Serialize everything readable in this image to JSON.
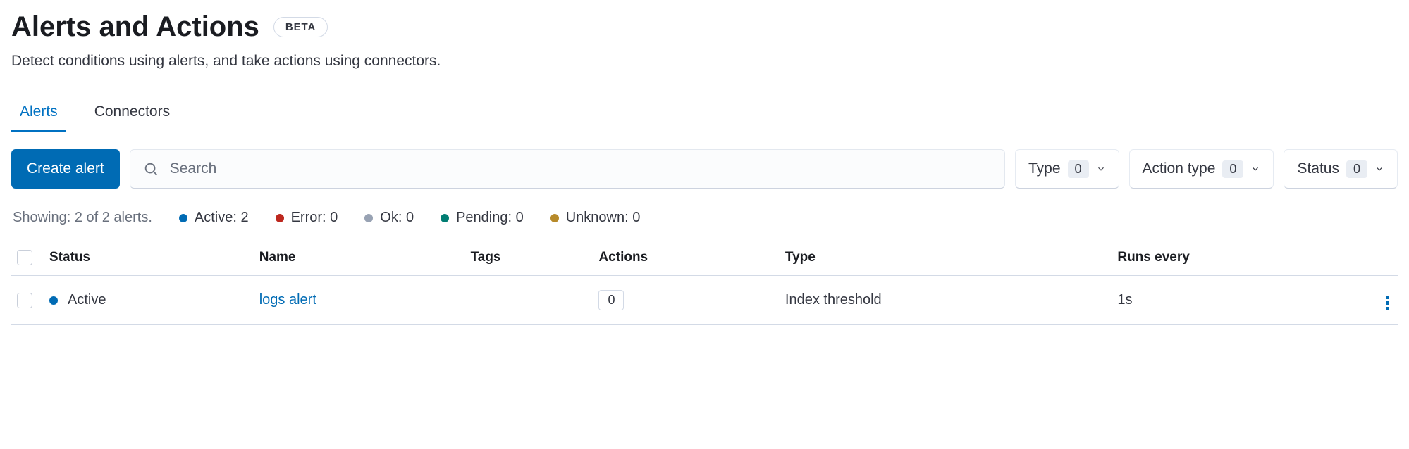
{
  "header": {
    "title": "Alerts and Actions",
    "badge": "BETA",
    "subtitle": "Detect conditions using alerts, and take actions using connectors."
  },
  "tabs": {
    "alerts": "Alerts",
    "connectors": "Connectors"
  },
  "toolbar": {
    "create_label": "Create alert",
    "search_placeholder": "Search"
  },
  "filters": {
    "type": {
      "label": "Type",
      "count": "0"
    },
    "action_type": {
      "label": "Action type",
      "count": "0"
    },
    "status": {
      "label": "Status",
      "count": "0"
    }
  },
  "summary": {
    "showing": "Showing: 2 of 2 alerts.",
    "items": [
      {
        "label": "Active: 2",
        "color": "#006bb4"
      },
      {
        "label": "Error: 0",
        "color": "#bd271e"
      },
      {
        "label": "Ok: 0",
        "color": "#98a2b3"
      },
      {
        "label": "Pending: 0",
        "color": "#017d73"
      },
      {
        "label": "Unknown: 0",
        "color": "#b78a2a"
      }
    ]
  },
  "table": {
    "headers": {
      "status": "Status",
      "name": "Name",
      "tags": "Tags",
      "actions": "Actions",
      "type": "Type",
      "runs_every": "Runs every"
    },
    "rows": [
      {
        "status_label": "Active",
        "status_color": "#006bb4",
        "name": "logs alert",
        "tags": "",
        "actions": "0",
        "type": "Index threshold",
        "runs_every": "1s"
      }
    ]
  }
}
